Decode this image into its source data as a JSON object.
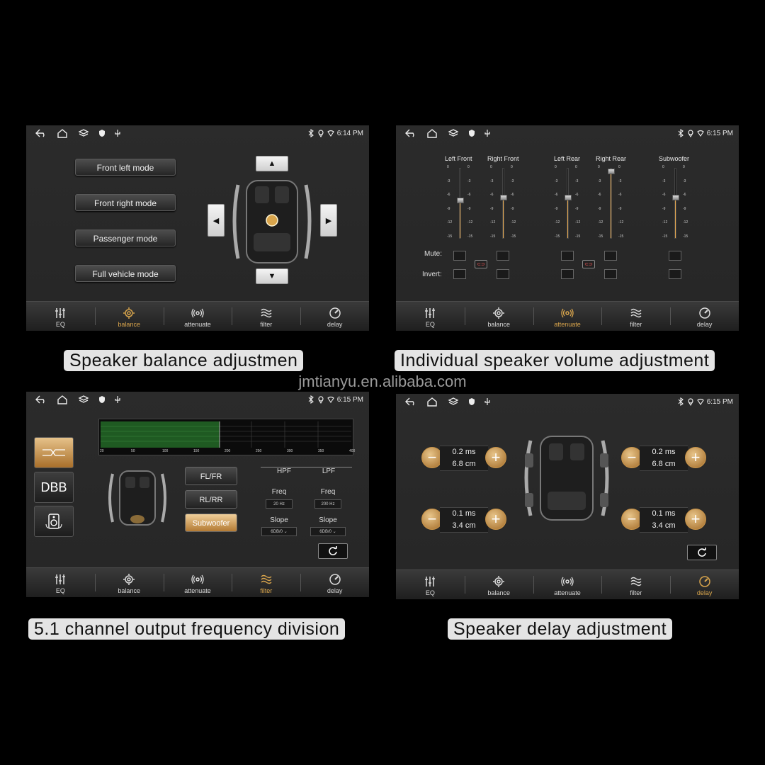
{
  "watermark": "jmtianyu.en.alibaba.com",
  "colors": {
    "accent": "#d9a54c",
    "background": "#000000",
    "screen": "#2a2a2a"
  },
  "tabs": [
    "EQ",
    "balance",
    "attenuate",
    "filter",
    "delay"
  ],
  "panels": [
    {
      "time": "6:14 PM",
      "active_tab": "balance",
      "caption": "Speaker balance adjustmen",
      "modes": [
        "Front left mode",
        "Front right mode",
        "Passenger mode",
        "Full vehicle mode"
      ],
      "arrow_icons": [
        "arrow-up-icon",
        "arrow-left-icon",
        "arrow-right-icon",
        "arrow-down-icon"
      ]
    },
    {
      "time": "6:15 PM",
      "active_tab": "attenuate",
      "caption": "Individual speaker volume adjustment",
      "channels": [
        {
          "name": "Left Front",
          "level": 0.55
        },
        {
          "name": "Right Front",
          "level": 0.6
        },
        {
          "name": "Left Rear",
          "level": 0.6
        },
        {
          "name": "Right Rear",
          "level": 1.0
        },
        {
          "name": "Subwoofer",
          "level": 0.6
        }
      ],
      "scale": [
        "0",
        "-3",
        "-6",
        "-9",
        "-12",
        "-15"
      ],
      "row_labels": {
        "mute": "Mute:",
        "invert": "Invert:"
      }
    },
    {
      "time": "6:15 PM",
      "active_tab": "filter",
      "caption": "5.1 channel output frequency division",
      "side_buttons": {
        "dbb": "DBB"
      },
      "freq_ticks": [
        "20",
        "50",
        "100",
        "150",
        "200",
        "250",
        "300",
        "350",
        "400"
      ],
      "channel_buttons": [
        "FL/FR",
        "RL/RR",
        "Subwoofer"
      ],
      "active_channel": "Subwoofer",
      "hpf": {
        "title": "HPF",
        "freq_label": "Freq",
        "freq": "20 Hz",
        "slope_label": "Slope",
        "slope": "6DB/0"
      },
      "lpf": {
        "title": "LPF",
        "freq_label": "Freq",
        "freq": "200 Hz",
        "slope_label": "Slope",
        "slope": "6DB/0"
      }
    },
    {
      "time": "6:15 PM",
      "active_tab": "delay",
      "caption": "Speaker delay adjustment",
      "delays": [
        {
          "ms": "0.2 ms",
          "cm": "6.8 cm"
        },
        {
          "ms": "0.2 ms",
          "cm": "6.8 cm"
        },
        {
          "ms": "0.1 ms",
          "cm": "3.4 cm"
        },
        {
          "ms": "0.1 ms",
          "cm": "3.4 cm"
        }
      ]
    }
  ]
}
